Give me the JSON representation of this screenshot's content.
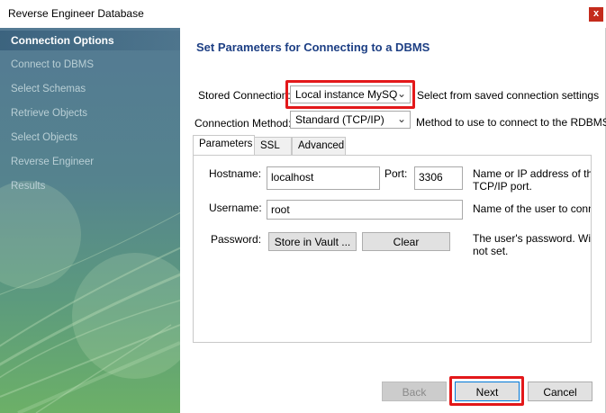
{
  "window": {
    "title": "Reverse Engineer Database",
    "close_glyph": "x"
  },
  "sidebar": {
    "items": [
      {
        "label": "Connection Options",
        "active": true
      },
      {
        "label": "Connect to DBMS",
        "active": false
      },
      {
        "label": "Select Schemas",
        "active": false
      },
      {
        "label": "Retrieve Objects",
        "active": false
      },
      {
        "label": "Select Objects",
        "active": false
      },
      {
        "label": "Reverse Engineer",
        "active": false
      },
      {
        "label": "Results",
        "active": false
      }
    ]
  },
  "main": {
    "heading": "Set Parameters for Connecting to a DBMS",
    "stored_connection": {
      "label": "Stored Connection:",
      "value": "Local instance MySQ",
      "hint": "Select from saved connection settings"
    },
    "connection_method": {
      "label": "Connection Method:",
      "value": "Standard (TCP/IP)",
      "hint": "Method to use to connect to the RDBMS"
    },
    "tabs": [
      {
        "label": "Parameters",
        "active": true
      },
      {
        "label": "SSL",
        "active": false
      },
      {
        "label": "Advanced",
        "active": false
      }
    ],
    "parameters": {
      "hostname_label": "Hostname:",
      "hostname_value": "localhost",
      "port_label": "Port:",
      "port_value": "3306",
      "hostname_desc_line1": "Name or IP address of the",
      "hostname_desc_line2": "TCP/IP port.",
      "username_label": "Username:",
      "username_value": "root",
      "username_desc": "Name of the user to conne",
      "password_label": "Password:",
      "store_vault_label": "Store in Vault ...",
      "clear_label": "Clear",
      "password_desc_line1": "The user's password. Will b",
      "password_desc_line2": "not set."
    }
  },
  "footer": {
    "back_label": "Back",
    "next_label": "Next",
    "cancel_label": "Cancel"
  },
  "colors": {
    "heading": "#1d3f84",
    "highlight": "#e3181a",
    "close": "#c42b1c"
  }
}
